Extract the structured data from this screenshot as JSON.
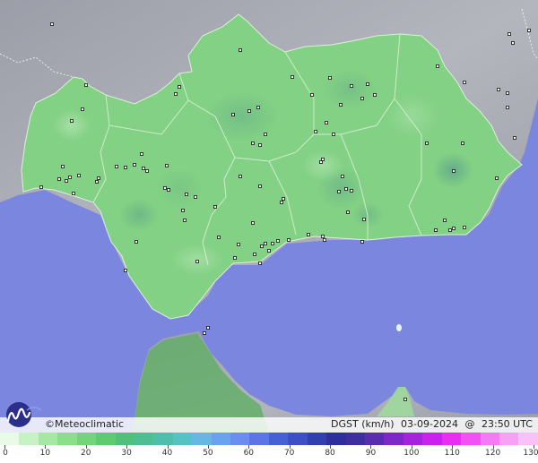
{
  "brand": {
    "copyright": "©",
    "name": "Meteoclimatic",
    "logo_icon": "meteoclimatic-logo-icon"
  },
  "info": {
    "variable": "DGST (km/h)",
    "date": "03-09-2024",
    "at": "@",
    "time": "23:50 UTC"
  },
  "scale": {
    "colors": [
      "#e8fbe6",
      "#c7f2c3",
      "#a6e8a3",
      "#8adf8b",
      "#72d57a",
      "#5ecb70",
      "#52c07a",
      "#4fbe92",
      "#4fbfab",
      "#56c2c6",
      "#66b8e2",
      "#6aa2ee",
      "#6d8cf0",
      "#5c74e6",
      "#4660d6",
      "#3c4fc4",
      "#3140ae",
      "#2e2f9c",
      "#3f2f9e",
      "#5a2cae",
      "#7e28c8",
      "#a424dc",
      "#c922ec",
      "#e92ef4",
      "#f252f4",
      "#f57af5",
      "#f7a0f6",
      "#f8c2f8"
    ],
    "ticks": [
      0,
      10,
      20,
      30,
      40,
      50,
      60,
      70,
      80,
      90,
      100,
      110,
      120,
      130
    ]
  },
  "map": {
    "sea_color": "#7b87df",
    "land_color": "#82d184",
    "foreign_land_color": "#a7a9b2",
    "station_icon": "station-marker-icon"
  }
}
